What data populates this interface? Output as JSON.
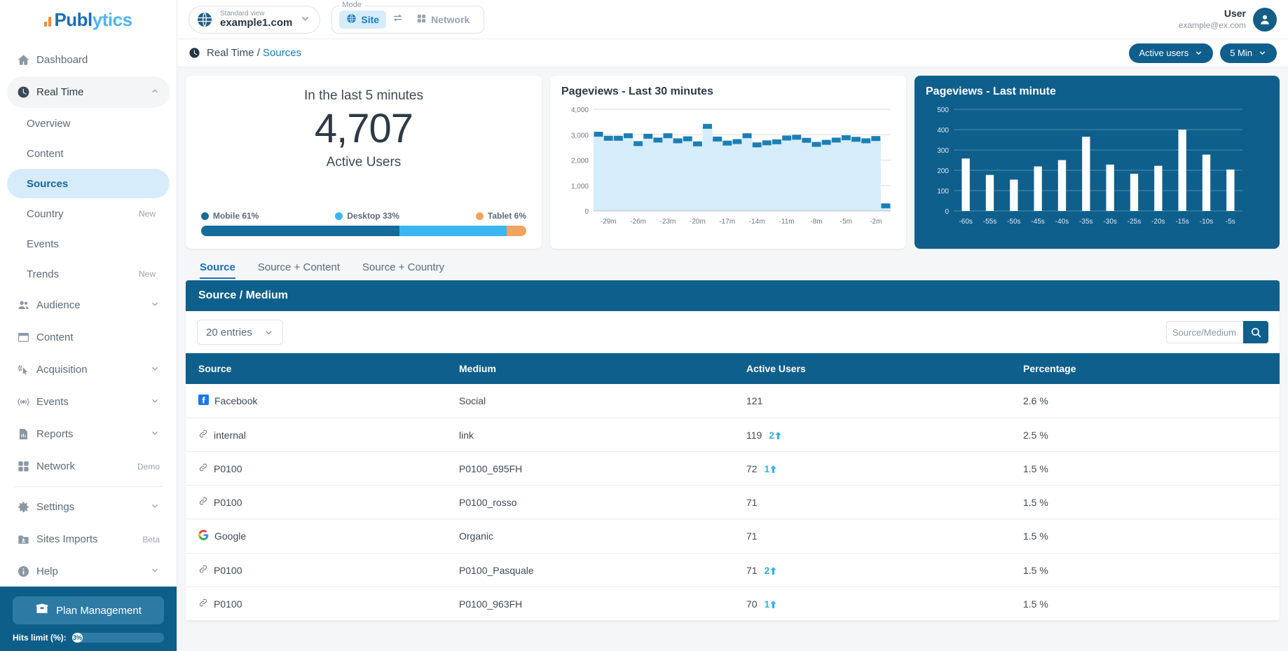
{
  "brand": {
    "name_part1": "Publ",
    "name_part2": "ytics"
  },
  "sidebar": {
    "items": [
      {
        "label": "Dashboard",
        "icon": "home-icon",
        "tag": "",
        "type": "item"
      },
      {
        "label": "Real Time",
        "icon": "clock-icon",
        "tag": "",
        "type": "group",
        "expanded": true
      },
      {
        "label": "Overview",
        "type": "sub"
      },
      {
        "label": "Content",
        "type": "sub"
      },
      {
        "label": "Sources",
        "type": "sub",
        "active": true
      },
      {
        "label": "Country",
        "type": "sub",
        "tag": "New"
      },
      {
        "label": "Events",
        "type": "sub"
      },
      {
        "label": "Trends",
        "type": "sub",
        "tag": "New"
      },
      {
        "label": "Audience",
        "icon": "people-icon",
        "type": "item",
        "chevron": true
      },
      {
        "label": "Content",
        "icon": "window-icon",
        "type": "item"
      },
      {
        "label": "Acquisition",
        "icon": "cursor-icon",
        "type": "item",
        "chevron": true
      },
      {
        "label": "Events",
        "icon": "broadcast-icon",
        "type": "item",
        "chevron": true
      },
      {
        "label": "Reports",
        "icon": "report-icon",
        "type": "item",
        "chevron": true
      },
      {
        "label": "Network",
        "icon": "grid-icon",
        "type": "item",
        "tag": "Demo"
      },
      {
        "label": "Settings",
        "icon": "gear-icon",
        "type": "item",
        "chevron": true
      },
      {
        "label": "Sites Imports",
        "icon": "download-icon",
        "type": "item",
        "tag": "Beta"
      },
      {
        "label": "Help",
        "icon": "info-icon",
        "type": "item",
        "chevron": true
      }
    ],
    "footer": {
      "plan_button": "Plan Management",
      "hits_label": "Hits limit (%):",
      "hits_value": "3%"
    }
  },
  "topbar": {
    "site_small": "Standard view",
    "site_name": "example1.com",
    "mode_legend": "Mode",
    "mode_site": "Site",
    "mode_network": "Network",
    "user_name": "User",
    "user_email": "example@ex.com"
  },
  "breadcrumb": {
    "parent": "Real Time /",
    "current": "Sources",
    "metric_button": "Active users",
    "range_button": "5 Min"
  },
  "summary_card": {
    "title": "In the last 5 minutes",
    "value": "4,707",
    "subtitle": "Active Users",
    "devices": [
      {
        "label": "Mobile 61%",
        "color": "#156c9b",
        "pct": 61
      },
      {
        "label": "Desktop 33%",
        "color": "#3cb6f0",
        "pct": 33
      },
      {
        "label": "Tablet 6%",
        "color": "#f2a35e",
        "pct": 6
      }
    ]
  },
  "chart_data": [
    {
      "type": "area",
      "title": "Pageviews - Last 30 minutes",
      "xlabel": "",
      "ylabel": "",
      "ylim": [
        0,
        4000
      ],
      "yticks": [
        0,
        1000,
        2000,
        3000,
        4000
      ],
      "ytick_labels": [
        "0",
        "1,000",
        "2,000",
        "3,000",
        "4,000"
      ],
      "xtick_labels": [
        "-29m",
        "-26m",
        "-23m",
        "-20m",
        "-17m",
        "-14m",
        "-11m",
        "-8m",
        "-5m",
        "-2m"
      ],
      "grid": true,
      "legend": "none",
      "x": [
        "-30m",
        "-29m",
        "-28m",
        "-27m",
        "-26m",
        "-25m",
        "-24m",
        "-23m",
        "-22m",
        "-21m",
        "-20m",
        "-19m",
        "-18m",
        "-17m",
        "-16m",
        "-15m",
        "-14m",
        "-13m",
        "-12m",
        "-11m",
        "-10m",
        "-9m",
        "-8m",
        "-7m",
        "-6m",
        "-5m",
        "-4m",
        "-3m",
        "-2m",
        "-1m"
      ],
      "values": [
        3020,
        2860,
        2860,
        2960,
        2650,
        2940,
        2790,
        2960,
        2760,
        2840,
        2640,
        3330,
        2830,
        2670,
        2730,
        2960,
        2600,
        2680,
        2720,
        2870,
        2900,
        2780,
        2620,
        2700,
        2790,
        2880,
        2820,
        2760,
        2850,
        200
      ],
      "series_color": "#1b7fb5",
      "fill_color": "#d5edfb"
    },
    {
      "type": "bar",
      "title": "Pageviews - Last minute",
      "xlabel": "",
      "ylabel": "",
      "ylim": [
        0,
        500
      ],
      "yticks": [
        0,
        100,
        200,
        300,
        400,
        500
      ],
      "ytick_labels": [
        "0",
        "100",
        "200",
        "300",
        "400",
        "500"
      ],
      "categories": [
        "-60s",
        "-55s",
        "-50s",
        "-45s",
        "-40s",
        "-35s",
        "-30s",
        "-25s",
        "-20s",
        "-15s",
        "-10s",
        "-5s"
      ],
      "values": [
        258,
        177,
        154,
        219,
        250,
        365,
        228,
        183,
        222,
        400,
        277,
        204
      ],
      "grid": true,
      "legend": "none",
      "bar_color": "#ffffff",
      "background": "#0f5f8c"
    }
  ],
  "tabs": [
    {
      "label": "Source",
      "active": true
    },
    {
      "label": "Source + Content",
      "active": false
    },
    {
      "label": "Source + Country",
      "active": false
    }
  ],
  "table": {
    "panel_title": "Source / Medium",
    "entries_label": "20 entries",
    "search_placeholder": "Source/Medium",
    "columns": [
      "Source",
      "Medium",
      "Active Users",
      "Percentage"
    ],
    "rows": [
      {
        "source": "Facebook",
        "icon": "facebook-icon",
        "medium": "Social",
        "users": "121",
        "delta": "",
        "percentage": "2.6 %"
      },
      {
        "source": "internal",
        "icon": "link-icon",
        "medium": "link",
        "users": "119",
        "delta": "2",
        "percentage": "2.5 %"
      },
      {
        "source": "P0100",
        "icon": "link-icon",
        "medium": "P0100_695FH",
        "users": "72",
        "delta": "1",
        "percentage": "1.5 %"
      },
      {
        "source": "P0100",
        "icon": "link-icon",
        "medium": "P0100_rosso",
        "users": "71",
        "delta": "",
        "percentage": "1.5 %"
      },
      {
        "source": "Google",
        "icon": "google-icon",
        "medium": "Organic",
        "users": "71",
        "delta": "",
        "percentage": "1.5 %"
      },
      {
        "source": "P0100",
        "icon": "link-icon",
        "medium": "P0100_Pasquale",
        "users": "71",
        "delta": "2",
        "percentage": "1.5 %"
      },
      {
        "source": "P0100",
        "icon": "link-icon",
        "medium": "P0100_963FH",
        "users": "70",
        "delta": "1",
        "percentage": "1.5 %"
      }
    ]
  }
}
